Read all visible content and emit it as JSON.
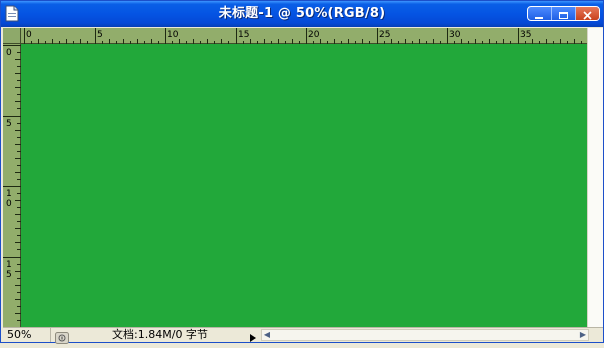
{
  "window": {
    "title": "未标题-1 @ 50%(RGB/8)",
    "canvas_color": "#22a83a",
    "icons": {
      "app": "document-icon",
      "minimize": "minimize-icon",
      "maximize": "maximize-icon",
      "close": "close-icon"
    }
  },
  "ruler": {
    "top_labels": [
      "0",
      "5",
      "10",
      "15",
      "20",
      "25",
      "30",
      "35"
    ],
    "left_labels": [
      "0",
      "5",
      "1\n0",
      "1\n5"
    ]
  },
  "statusbar": {
    "zoom": "50%",
    "doc_info": "文档:1.84M/0 字节",
    "menu_arrow": "▶",
    "scroll_left": "◀",
    "scroll_right": "▶"
  }
}
